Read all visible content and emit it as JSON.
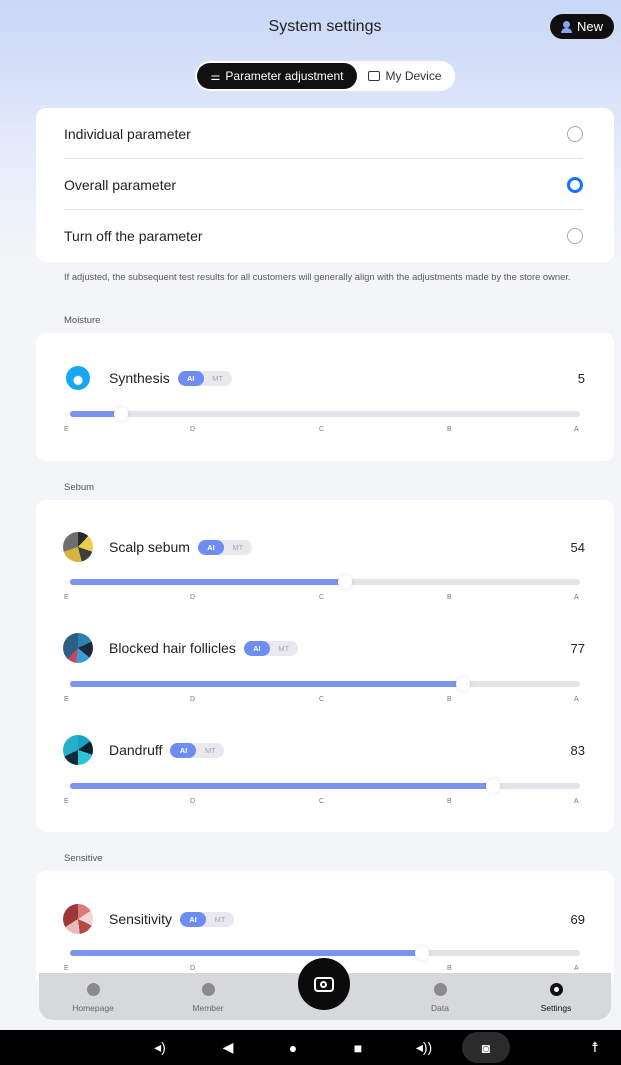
{
  "header": {
    "title": "System settings",
    "new_label": "New"
  },
  "tabs": [
    {
      "label": "Parameter adjustment",
      "active": true
    },
    {
      "label": "My Device",
      "active": false
    }
  ],
  "parameter_options": [
    {
      "label": "Individual parameter",
      "selected": false
    },
    {
      "label": "Overall parameter",
      "selected": true
    },
    {
      "label": "Turn off the parameter",
      "selected": false
    }
  ],
  "note": "If adjusted, the subsequent test results for all customers will generally align with the adjustments made by the store owner.",
  "scale_labels": [
    "E",
    "D",
    "C",
    "B",
    "A"
  ],
  "badge": {
    "ai": "AI",
    "mt": "MT"
  },
  "sections": {
    "moisture": {
      "label": "Moisture",
      "items": [
        {
          "name": "Synthesis",
          "value": "5",
          "level": 0.1
        }
      ]
    },
    "sebum": {
      "label": "Sebum",
      "items": [
        {
          "name": "Scalp sebum",
          "value": "54",
          "level": 0.54
        },
        {
          "name": "Blocked hair follicles",
          "value": "77",
          "level": 0.77
        },
        {
          "name": "Dandruff",
          "value": "83",
          "level": 0.83
        }
      ]
    },
    "sensitive": {
      "label": "Sensitive",
      "items": [
        {
          "name": "Sensitivity",
          "value": "69",
          "level": 0.69
        }
      ]
    }
  },
  "bottom_nav": [
    {
      "label": "Homepage",
      "icon": "home-icon",
      "active": false
    },
    {
      "label": "Member",
      "icon": "member-icon",
      "active": false
    },
    {
      "label": "Data",
      "icon": "data-icon",
      "active": false
    },
    {
      "label": "Settings",
      "icon": "settings-icon",
      "active": true
    }
  ],
  "colors": {
    "accent": "#1672ff",
    "slider_fill": "#7b95ef",
    "ai_badge": "#6f8cf2"
  }
}
